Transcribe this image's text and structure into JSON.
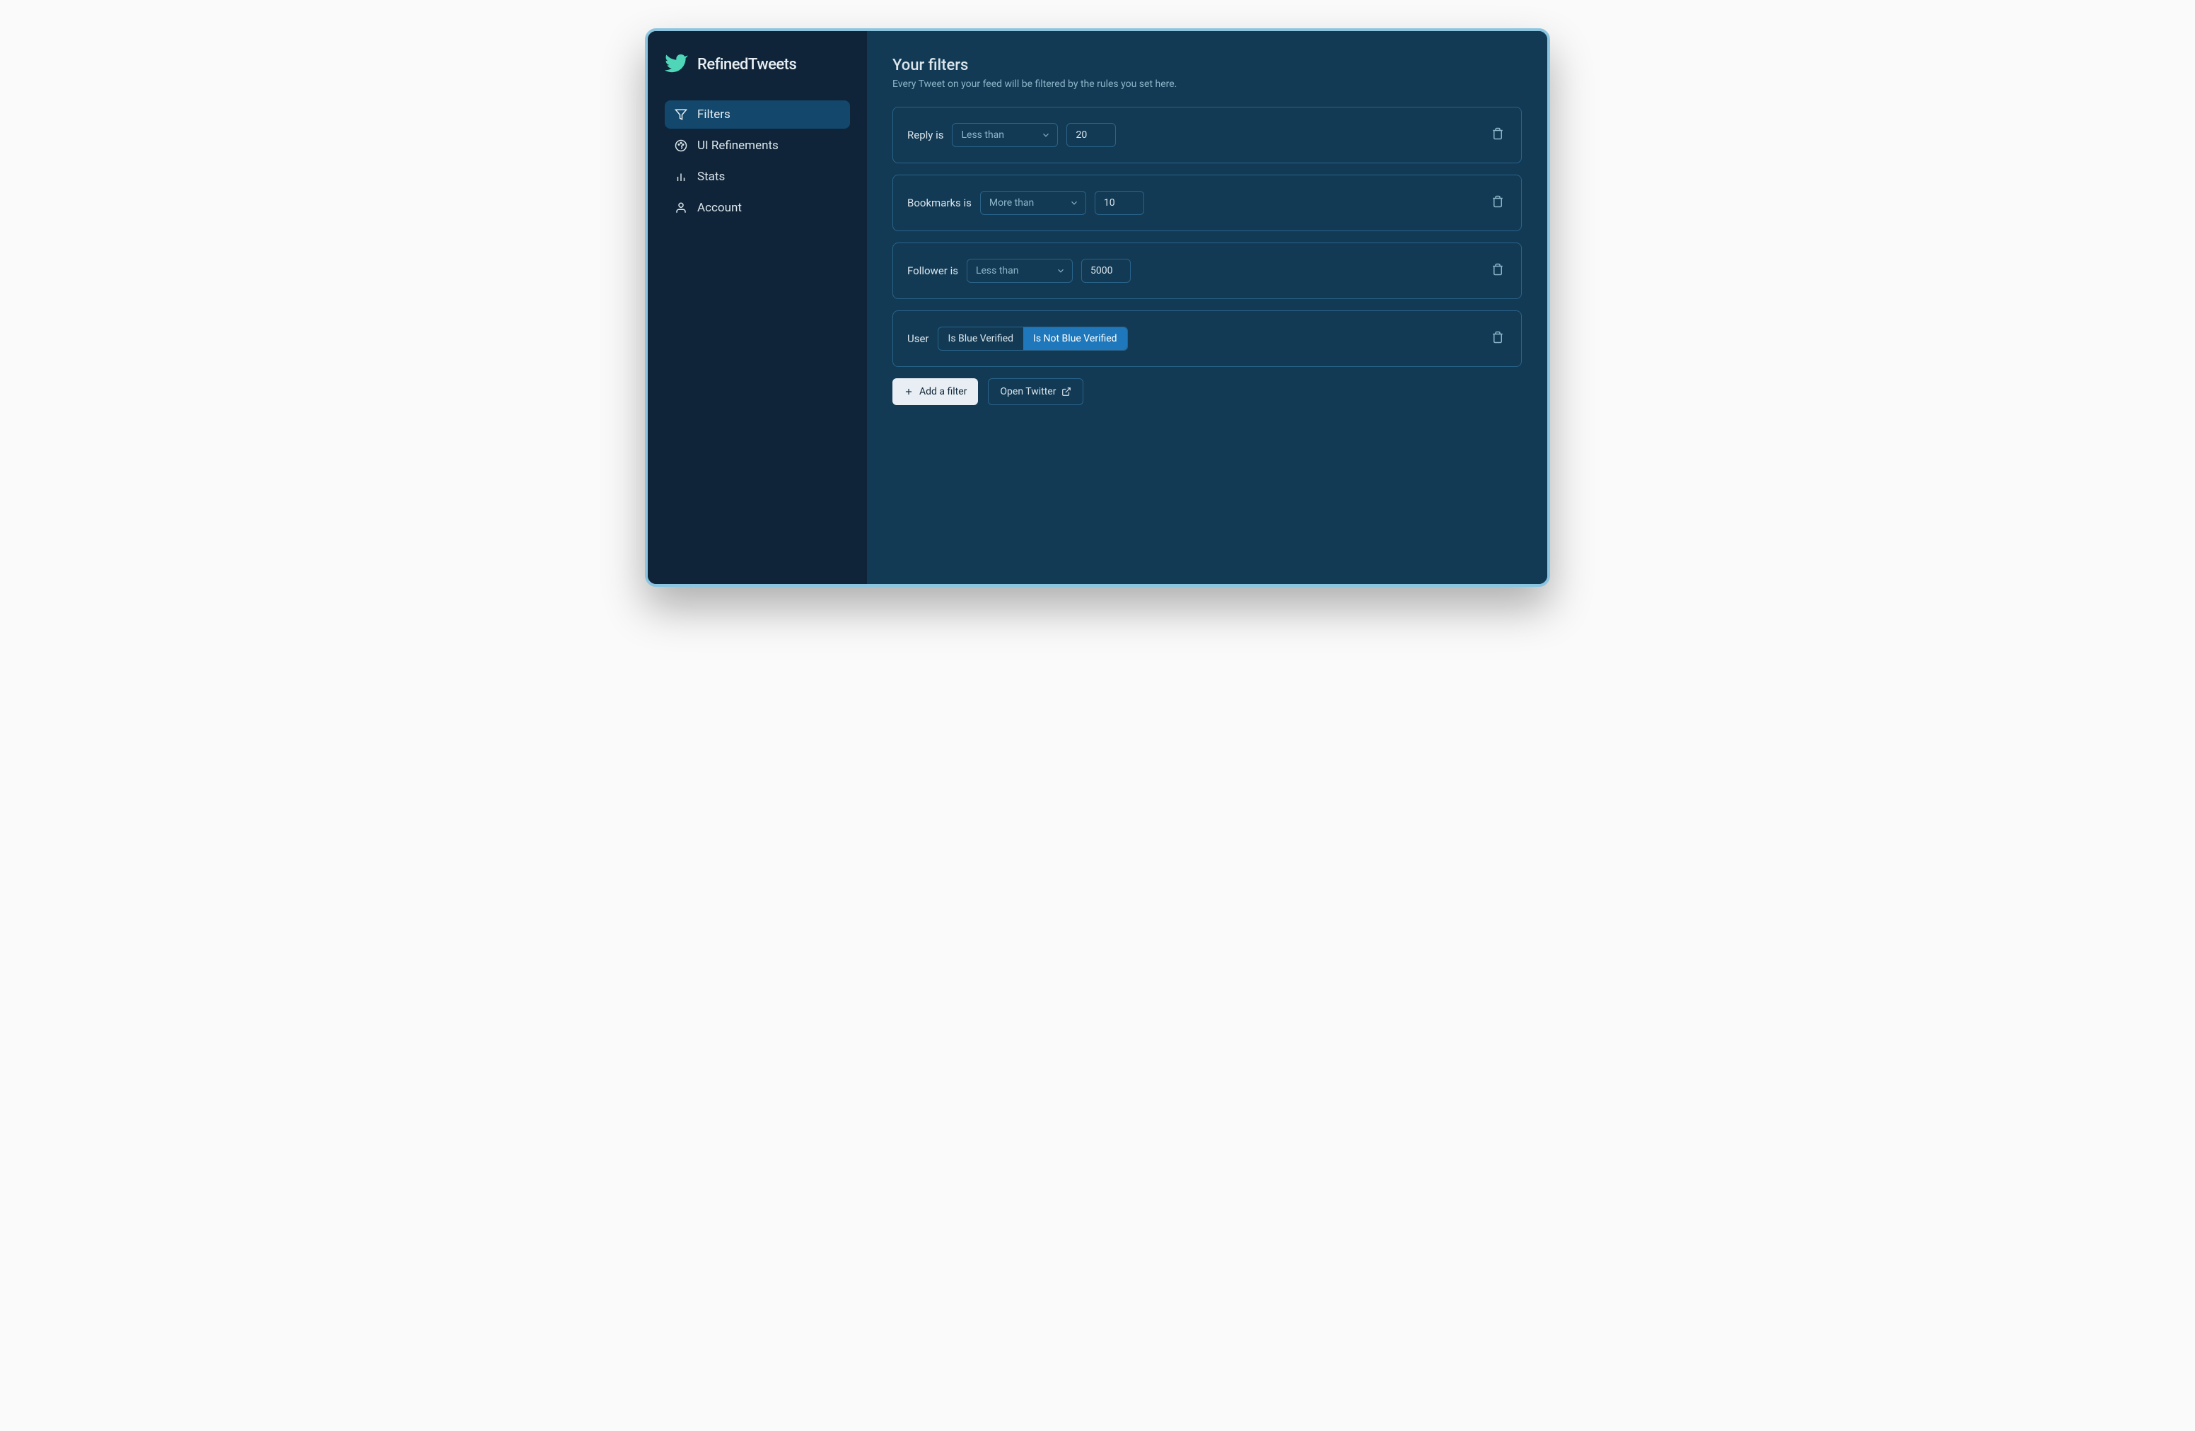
{
  "brand": {
    "name": "RefinedTweets"
  },
  "sidebar": {
    "items": [
      {
        "label": "Filters",
        "icon": "filter-icon",
        "active": true
      },
      {
        "label": "UI Refinements",
        "icon": "palette-icon",
        "active": false
      },
      {
        "label": "Stats",
        "icon": "chart-icon",
        "active": false
      },
      {
        "label": "Account",
        "icon": "user-icon",
        "active": false
      }
    ]
  },
  "page": {
    "title": "Your filters",
    "subtitle": "Every Tweet on your feed will be filtered by the rules you set here."
  },
  "filters": [
    {
      "label": "Reply is",
      "comparator": "Less than",
      "value": "20",
      "type": "numeric"
    },
    {
      "label": "Bookmarks is",
      "comparator": "More than",
      "value": "10",
      "type": "numeric"
    },
    {
      "label": "Follower is",
      "comparator": "Less than",
      "value": "5000",
      "type": "numeric"
    },
    {
      "label": "User",
      "type": "toggle",
      "options": [
        "Is Blue Verified",
        "Is Not Blue Verified"
      ],
      "selected": 1
    }
  ],
  "actions": {
    "add_filter": "Add a filter",
    "open_twitter": "Open Twitter"
  }
}
